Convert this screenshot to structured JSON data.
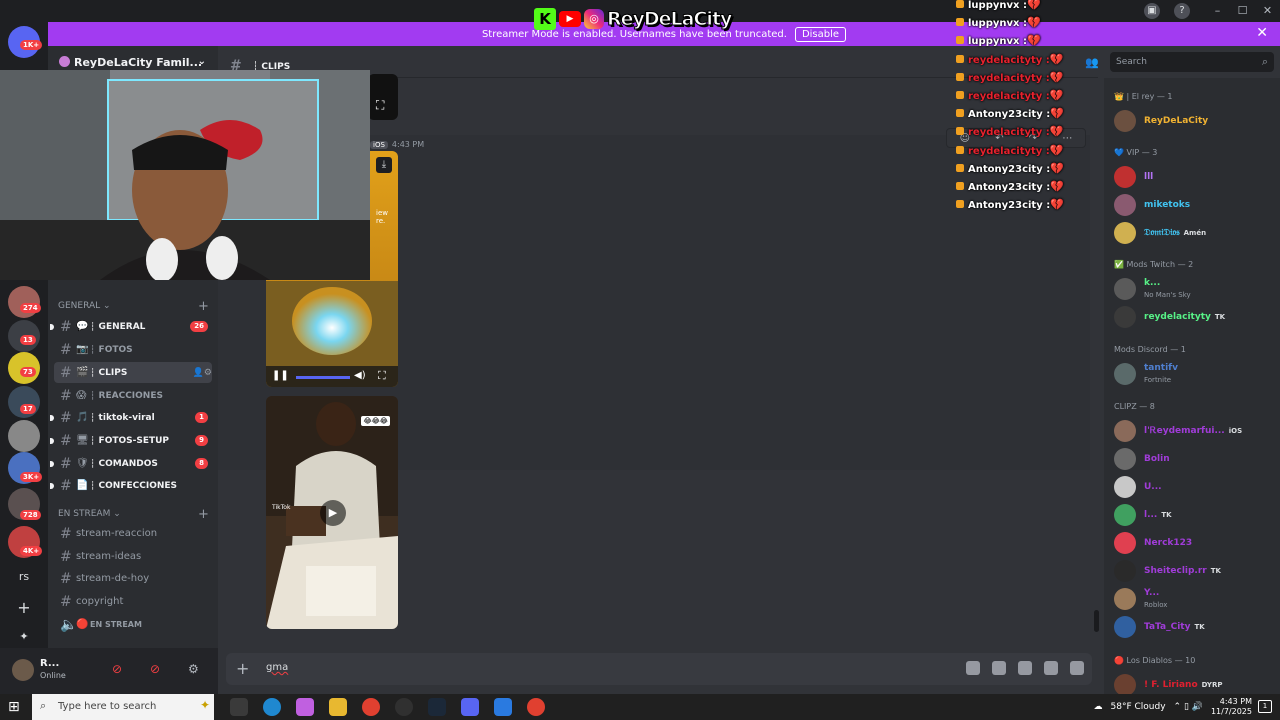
{
  "brand": {
    "name": "ReyDeLaCity",
    "kick": "K",
    "youtube": "▶",
    "instagram": "◎"
  },
  "banner": {
    "text": "Streamer Mode is enabled. Usernames have been truncated.",
    "button": "Disable",
    "close": "✕"
  },
  "window": {
    "minimize": "–",
    "maximize": "☐",
    "close": "✕"
  },
  "server": {
    "name": "ReyDeLaCity Famil...",
    "chevron": "⌄"
  },
  "rail": {
    "badges": [
      "1K+",
      "274",
      "13",
      "73",
      "17",
      "3K+",
      "728",
      "4K+"
    ],
    "text_server": "rs",
    "add": "+",
    "explore": "✦"
  },
  "categories": [
    {
      "name": "GENERAL",
      "plus": "+"
    },
    {
      "name": "EN STREAM",
      "plus": "+"
    }
  ],
  "channels_general": [
    {
      "emoji": "💬",
      "label": "┆ GENERAL",
      "count": "26",
      "unread": true
    },
    {
      "emoji": "📷",
      "label": "┆ FOTOS",
      "count": "",
      "unread": false
    },
    {
      "emoji": "🎬",
      "label": "┆ CLIPS",
      "count": "",
      "unread": false,
      "selected": true
    },
    {
      "emoji": "😱",
      "label": "┆ REACCIONES",
      "count": "",
      "unread": false
    },
    {
      "emoji": "🎵",
      "label": "┆ tiktok-viral",
      "count": "1",
      "unread": true
    },
    {
      "emoji": "🖥",
      "label": "┆ FOTOS-SETUP",
      "count": "9",
      "unread": true
    },
    {
      "emoji": "🛡",
      "label": "┆ COMANDOS",
      "count": "8",
      "unread": true
    },
    {
      "emoji": "📄",
      "label": "┆ CONFECCIONES",
      "count": "",
      "unread": true
    }
  ],
  "channels_stream": [
    {
      "label": "stream-reaccion"
    },
    {
      "label": "stream-ideas"
    },
    {
      "label": "stream-de-hoy"
    },
    {
      "label": "copyright"
    },
    {
      "label": "EN STREAM",
      "voice": true
    }
  ],
  "user": {
    "name": "R...",
    "status": "Online"
  },
  "header": {
    "channel": "┆ CLIPS"
  },
  "message": {
    "platform": "iOS",
    "time": "4:43 PM"
  },
  "video_overlay_text": "iew\nre.",
  "video2_emoji": "😂😂😂",
  "video2_label": "TikTok",
  "composer": {
    "text": "gma",
    "add": "+"
  },
  "search": {
    "placeholder": "Search"
  },
  "member_groups": [
    {
      "title": "👑 | El rey — 1",
      "members": [
        {
          "name": "ReyDeLaCity",
          "color": "#f0b232",
          "sub": "",
          "tag": ""
        }
      ]
    },
    {
      "title": "💙 VIP — 3",
      "members": [
        {
          "name": "lll",
          "color": "#b473f5",
          "sub": "",
          "tag": ""
        },
        {
          "name": "miketoks",
          "color": "#41c3f0",
          "sub": "",
          "tag": ""
        },
        {
          "name": "𝔇𝔬𝔪𝔦𝔇𝔦𝔬𝔰",
          "color": "#41c3f0",
          "sub": "",
          "tag": "Amén"
        }
      ]
    },
    {
      "title": "✅ Mods Twitch — 2",
      "members": [
        {
          "name": "k...",
          "color": "#57f287",
          "sub": "No Man's Sky",
          "tag": ""
        },
        {
          "name": "reydelacityty",
          "color": "#57f287",
          "sub": "",
          "tag": "TK"
        }
      ]
    },
    {
      "title": "Mods Discord — 1",
      "members": [
        {
          "name": "tantifv",
          "color": "#4f7fcf",
          "sub": "Fortnite",
          "tag": ""
        }
      ]
    },
    {
      "title": "CLIPZ — 8",
      "members": [
        {
          "name": "l'Ꭱеуdеmаrfuі...",
          "color": "#a03cd8",
          "sub": "",
          "tag": "iOS"
        },
        {
          "name": "Bolin",
          "color": "#a03cd8",
          "sub": "",
          "tag": ""
        },
        {
          "name": "U...",
          "color": "#a03cd8",
          "sub": "",
          "tag": ""
        },
        {
          "name": "l...",
          "color": "#a03cd8",
          "sub": "",
          "tag": "TK"
        },
        {
          "name": "Nerck123",
          "color": "#a03cd8",
          "sub": "",
          "tag": ""
        },
        {
          "name": "Sheiteclip.rr",
          "color": "#a03cd8",
          "sub": "",
          "tag": "TK"
        },
        {
          "name": "Y...",
          "color": "#a03cd8",
          "sub": "Roblox",
          "tag": ""
        },
        {
          "name": "TaTa_City",
          "color": "#a03cd8",
          "sub": "",
          "tag": "TK"
        }
      ]
    },
    {
      "title": "🔴 Los Diablos — 10",
      "members": [
        {
          "name": "! F. Liriano",
          "color": "#e02030",
          "sub": "",
          "tag": "DYRP"
        }
      ]
    }
  ],
  "chat_overlay": [
    {
      "user": "luppynvx :",
      "color": "#ffffff"
    },
    {
      "user": "luppynvx :",
      "color": "#ffffff"
    },
    {
      "user": "luppynvx :",
      "color": "#ffffff"
    },
    {
      "user": "reydelacityty :",
      "color": "#e8222e"
    },
    {
      "user": "reydelacityty :",
      "color": "#e8222e"
    },
    {
      "user": "reydelacityty :",
      "color": "#e8222e"
    },
    {
      "user": "Antony23city :",
      "color": "#ffffff"
    },
    {
      "user": "reydelacityty :",
      "color": "#e8222e"
    },
    {
      "user": "reydelacityty :",
      "color": "#e8222e"
    },
    {
      "user": "Antony23city :",
      "color": "#ffffff"
    },
    {
      "user": "Antony23city :",
      "color": "#ffffff"
    },
    {
      "user": "Antony23city :",
      "color": "#ffffff"
    }
  ],
  "chat_heart": "💔",
  "taskbar": {
    "search_placeholder": "Type here to search",
    "weather": "58°F  Cloudy",
    "time": "4:43 PM",
    "date": "11/7/2025",
    "start": "⊞",
    "notif": "1"
  },
  "colors": {
    "banner": "#a23bf1",
    "unread_badge": "#f23f43",
    "kick": "#53fc18"
  }
}
